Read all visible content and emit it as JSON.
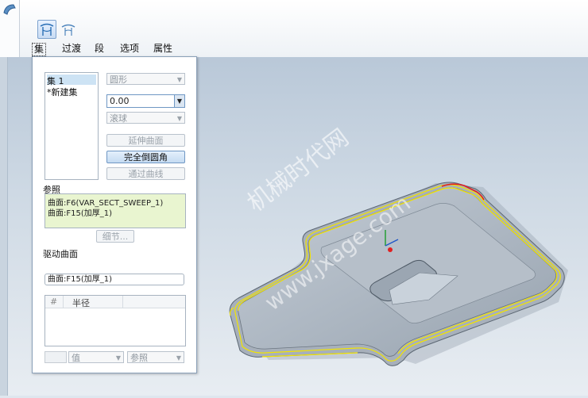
{
  "dashboard": {
    "tabs": [
      "集",
      "过渡",
      "段",
      "选项",
      "属性"
    ],
    "tools": [
      "rolling-ball-round-icon",
      "variable-round-icon"
    ]
  },
  "sets_panel": {
    "set_list": [
      "集 1",
      "*新建集"
    ],
    "shape_combo": "圆形",
    "radius_value": "0.00",
    "method_combo": "滚球",
    "buttons": {
      "extend_surfaces": "延伸曲面",
      "full_round": "完全倒圆角",
      "through_curve": "通过曲线"
    },
    "references_label": "参照",
    "references": [
      "曲面:F6(VAR_SECT_SWEEP_1)",
      "曲面:F15(加厚_1)"
    ],
    "details_button": "细节...",
    "driving_surface_label": "驱动曲面",
    "driving_surface_value": "曲面:F15(加厚_1)",
    "radius_table": {
      "columns": [
        "#",
        "半径"
      ]
    },
    "value_combo": "值",
    "reference_combo": "参照"
  },
  "watermark": {
    "line1": "机械时代网",
    "line2": "www.jxage.com"
  },
  "colors": {
    "accent": "#c5dbf2",
    "references_bg": "#e9f5d0",
    "part_body": "#9aa5b1",
    "edge_highlight": "#f2e400",
    "selected_edge": "#e02020"
  }
}
